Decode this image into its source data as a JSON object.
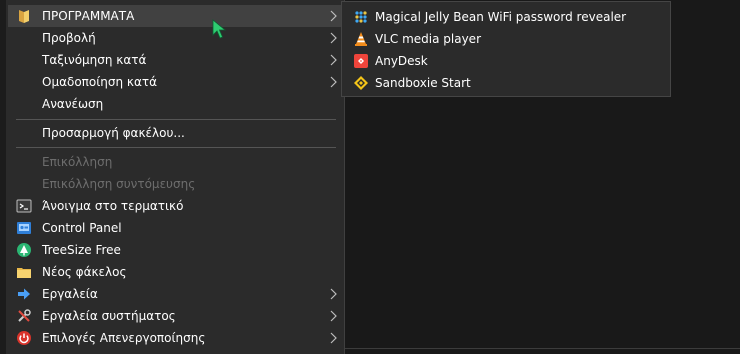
{
  "menu": {
    "items": [
      {
        "label": "ΠΡΟΓΡΑΜΜΑΤΑ",
        "icon": "folder-icon",
        "submenu": true
      },
      {
        "label": "Προβολή",
        "icon": "",
        "submenu": true
      },
      {
        "label": "Ταξινόμηση κατά",
        "icon": "",
        "submenu": true
      },
      {
        "label": "Ομαδοποίηση κατά",
        "icon": "",
        "submenu": true
      },
      {
        "label": "Ανανέωση",
        "icon": "",
        "submenu": false
      },
      {
        "label": "Προσαρμογή φακέλου...",
        "icon": "",
        "submenu": false
      },
      {
        "label": "Επικόλληση",
        "icon": "",
        "submenu": false,
        "disabled": true
      },
      {
        "label": "Επικόλληση συντόμευσης",
        "icon": "",
        "submenu": false,
        "disabled": true
      },
      {
        "label": "Άνοιγμα στο τερματικό",
        "icon": "terminal-icon",
        "submenu": false
      },
      {
        "label": "Control Panel",
        "icon": "control-panel-icon",
        "submenu": false
      },
      {
        "label": "TreeSize Free",
        "icon": "treesize-icon",
        "submenu": false
      },
      {
        "label": "Νέος φάκελος",
        "icon": "folder-icon",
        "submenu": false
      },
      {
        "label": "Εργαλεία",
        "icon": "arrow-right-icon",
        "submenu": true
      },
      {
        "label": "Εργαλεία συστήματος",
        "icon": "tools-icon",
        "submenu": true
      },
      {
        "label": "Επιλογές Απενεργοποίησης",
        "icon": "power-icon",
        "submenu": true
      }
    ]
  },
  "submenu": {
    "items": [
      {
        "label": "Magical Jelly Bean WiFi password revealer",
        "icon": "magical-jelly-bean-icon"
      },
      {
        "label": "VLC media player",
        "icon": "vlc-cone-icon"
      },
      {
        "label": "AnyDesk",
        "icon": "anydesk-icon"
      },
      {
        "label": "Sandboxie Start",
        "icon": "sandboxie-icon"
      }
    ]
  },
  "colors": {
    "menu_bg": "#2b2b2b",
    "hover_bg": "#414141",
    "text": "#ffffff",
    "disabled_text": "#6d6d6d",
    "cursor": "#2ecc71"
  }
}
